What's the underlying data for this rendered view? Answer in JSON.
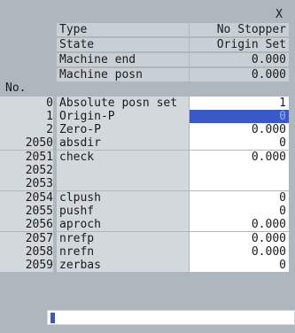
{
  "axis_label": "X",
  "no_label": "No.",
  "info": [
    {
      "label": "Type",
      "value": "No Stopper"
    },
    {
      "label": "State",
      "value": "Origin Set"
    },
    {
      "label": "Machine end",
      "value": "0.000"
    },
    {
      "label": "Machine posn",
      "value": "0.000"
    }
  ],
  "params": [
    {
      "no": "0",
      "name": "Absolute posn set",
      "value": "1"
    },
    {
      "no": "1",
      "name": "Origin-P",
      "value": "0"
    },
    {
      "no": "2",
      "name": "Zero-P",
      "value": "0.000"
    },
    {
      "no": "2050",
      "name": "absdir",
      "value": "0"
    },
    {
      "no": "2051",
      "name": "check",
      "value": "0.000"
    },
    {
      "no": "2052",
      "name": "",
      "value": ""
    },
    {
      "no": "2053",
      "name": "",
      "value": ""
    },
    {
      "no": "2054",
      "name": "clpush",
      "value": "0"
    },
    {
      "no": "2055",
      "name": "pushf",
      "value": "0"
    },
    {
      "no": "2056",
      "name": "aproch",
      "value": "0.000"
    },
    {
      "no": "2057",
      "name": "nrefp",
      "value": "0.000"
    },
    {
      "no": "2058",
      "name": "nrefn",
      "value": "0.000"
    },
    {
      "no": "2059",
      "name": "zerbas",
      "value": "0"
    }
  ],
  "selected_row": 1,
  "input": {
    "value": ""
  }
}
